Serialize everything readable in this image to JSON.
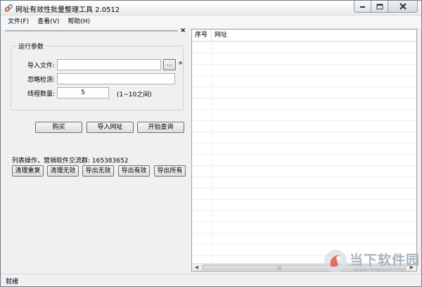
{
  "window": {
    "title": "网址有效性批量整理工具 2.0512"
  },
  "menu": [
    "文件(F)",
    "查看(V)",
    "帮助(H)"
  ],
  "panel": {
    "close_glyph": "×"
  },
  "params": {
    "group_title": "运行参数",
    "import_file_label": "导入文件:",
    "import_file_value": "",
    "browse_label": "...",
    "required_mark": "*",
    "ignore_label": "忽略检测:",
    "ignore_value": "",
    "threads_label": "线程数量:",
    "threads_value": "5",
    "threads_hint": "(1~10之间)"
  },
  "actions": {
    "buy": "购买",
    "import_urls": "导入网址",
    "start_query": "开始查询"
  },
  "list_ops": {
    "label": "列表操作，营销软件交流群: 165383652",
    "buttons": [
      "清理重复",
      "清理无效",
      "导出无效",
      "导出有效",
      "导出所有"
    ]
  },
  "list": {
    "columns": [
      "序号",
      "网址"
    ],
    "rows": []
  },
  "status": {
    "text": "就绪"
  },
  "watermark": {
    "name": "当下软件园",
    "url": "www.downxia.com"
  },
  "icons": {
    "app": "link-icon",
    "minimize": "minimize-icon",
    "maximize": "maximize-icon",
    "close": "close-icon"
  },
  "colors": {
    "window_border": "#6e7d8c",
    "close_button": "#c75050"
  }
}
